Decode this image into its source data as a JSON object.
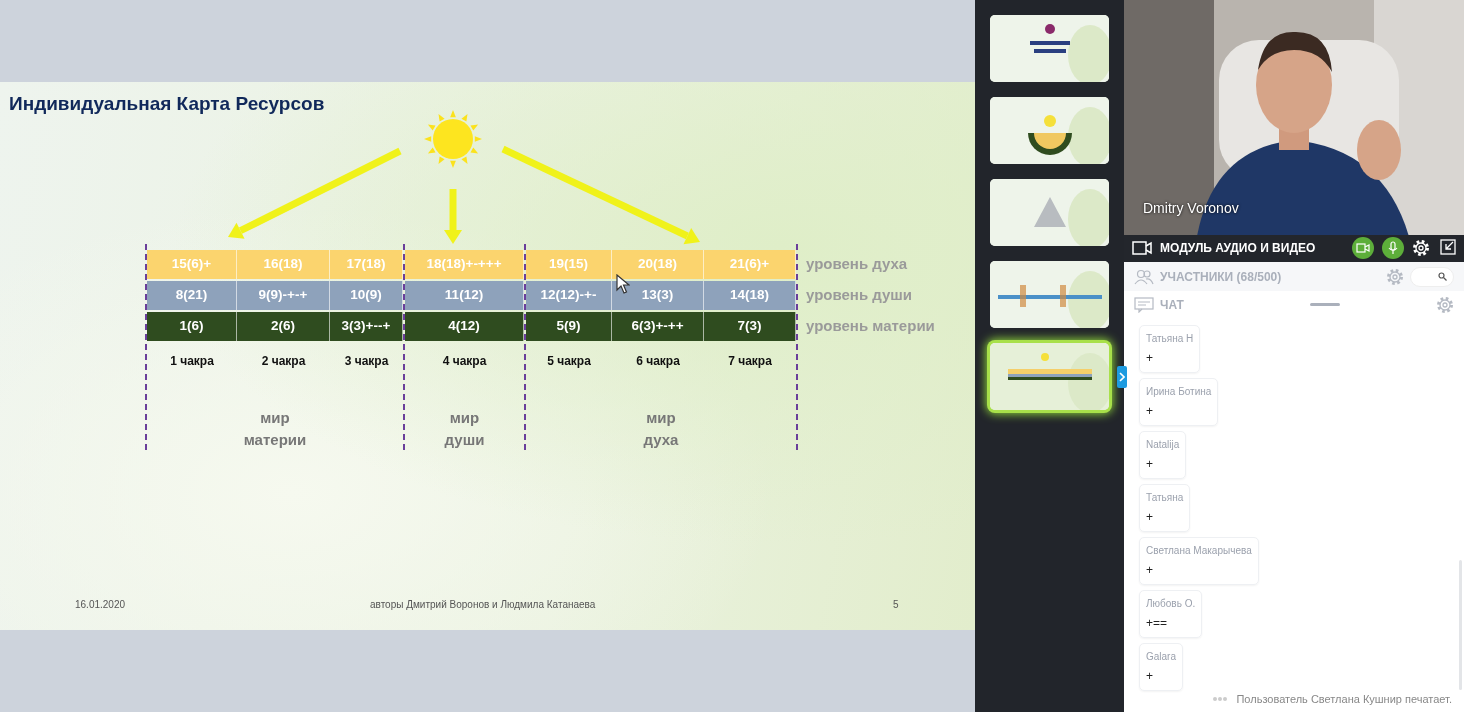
{
  "slide": {
    "title": "Индивидуальная Карта Ресурсов",
    "row_labels": [
      "уровень духа",
      "уровень души",
      "уровень материи"
    ],
    "groups": [
      {
        "world": "мир\nматерии",
        "columns": [
          {
            "spirit": "15(6)+",
            "soul": "8(21)",
            "matter": "1(6)",
            "chakra": "1 чакра"
          },
          {
            "spirit": "16(18)",
            "soul": "9(9)-+-+",
            "matter": "2(6)",
            "chakra": "2 чакра"
          },
          {
            "spirit": "17(18)",
            "soul": "10(9)",
            "matter": "3(3)+--+",
            "chakra": "3 чакра"
          }
        ]
      },
      {
        "world": "мир\nдуши",
        "columns": [
          {
            "spirit": "18(18)+-+++",
            "soul": "11(12)",
            "matter": "4(12)",
            "chakra": "4 чакра"
          }
        ]
      },
      {
        "world": "мир\nдуха",
        "columns": [
          {
            "spirit": "19(15)",
            "soul": "12(12)-+-",
            "matter": "5(9)",
            "chakra": "5 чакра"
          },
          {
            "spirit": "20(18)",
            "soul": "13(3)",
            "matter": "6(3)+-++",
            "chakra": "6 чакра"
          },
          {
            "spirit": "21(6)+",
            "soul": "14(18)",
            "matter": "7(3)",
            "chakra": "7 чакра"
          }
        ]
      }
    ],
    "footer": {
      "date": "16.01.2020",
      "authors": "авторы Дмитрий Воронов и Людмила Катанаева",
      "page": "5"
    }
  },
  "thumbnails": [
    {
      "selected": false
    },
    {
      "selected": false
    },
    {
      "selected": false
    },
    {
      "selected": false
    },
    {
      "selected": true
    }
  ],
  "video": {
    "speaker": "Dmitry Voronov"
  },
  "module_bar": {
    "title": "МОДУЛЬ АУДИО И ВИДЕО",
    "camera_on": true,
    "mic_on": true
  },
  "participants": {
    "label": "УЧАСТНИКИ (68/500)"
  },
  "chat": {
    "label": "ЧАТ",
    "messages": [
      {
        "author": "Татьяна Н",
        "text": "+"
      },
      {
        "author": "Ирина Ботина",
        "text": "+"
      },
      {
        "author": "Natalija",
        "text": "+"
      },
      {
        "author": "Татьяна",
        "text": "+"
      },
      {
        "author": "Светлана Макарычева",
        "text": "+"
      },
      {
        "author": "Любовь О.",
        "text": "+=="
      },
      {
        "author": "Galara",
        "text": "+"
      }
    ],
    "typing": "Пользователь Светлана Кушнир печатает."
  }
}
